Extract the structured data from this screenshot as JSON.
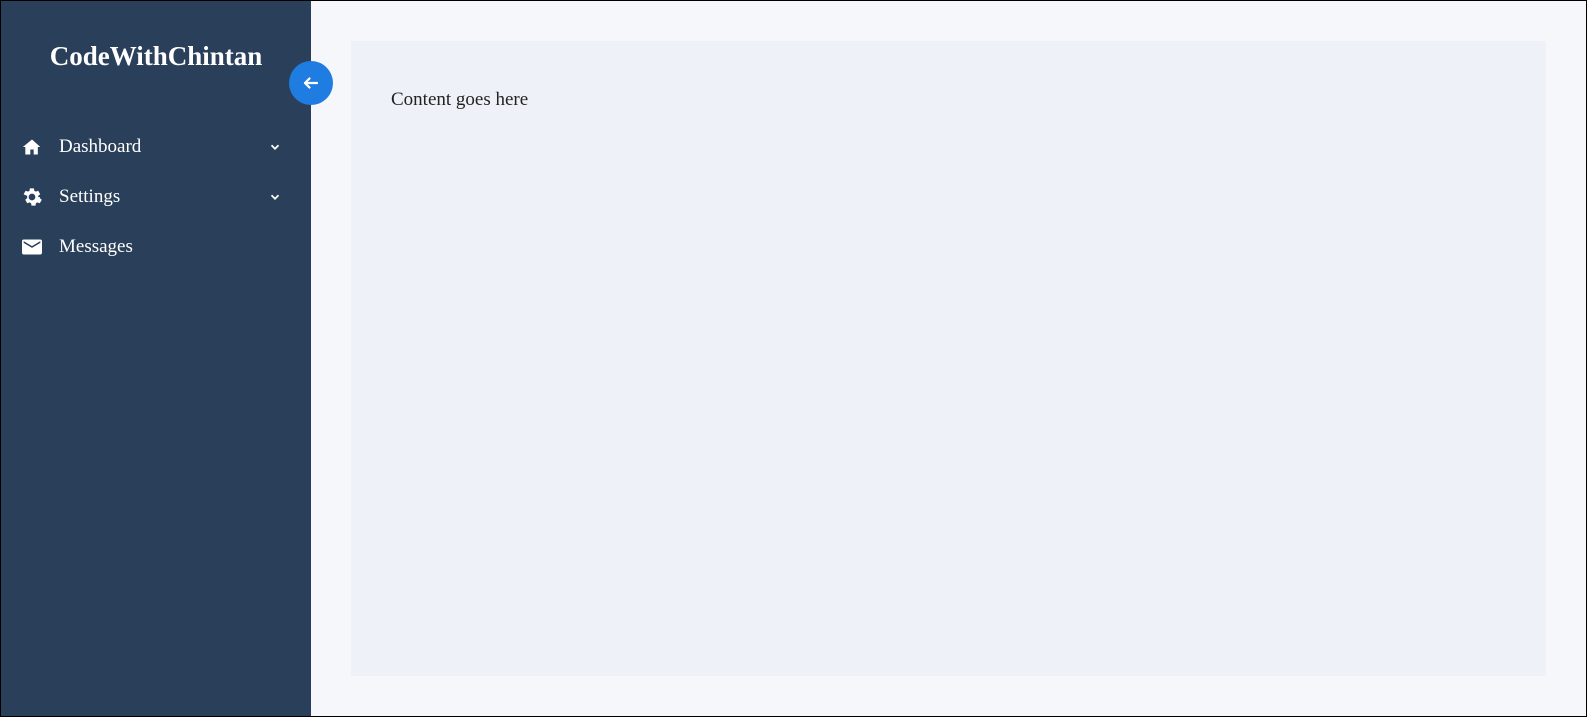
{
  "brand": "CodeWithChintan",
  "sidebar": {
    "items": [
      {
        "label": "Dashboard",
        "icon": "home",
        "expandable": true
      },
      {
        "label": "Settings",
        "icon": "gear",
        "expandable": true
      },
      {
        "label": "Messages",
        "icon": "envelope",
        "expandable": false
      }
    ]
  },
  "main": {
    "content": "Content goes here"
  }
}
